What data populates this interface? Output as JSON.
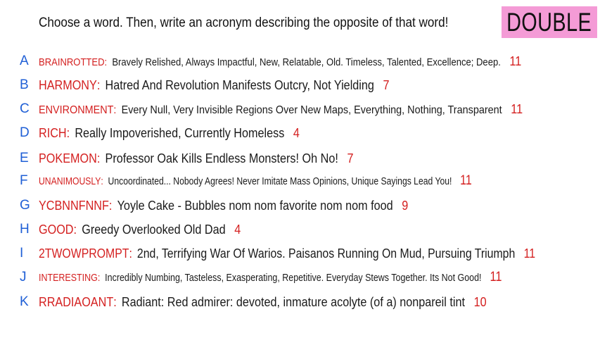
{
  "prompt": "Choose a word. Then, write an acronym describing the opposite of that word!",
  "badge": "DOUBLE",
  "answers": [
    {
      "letter": "A",
      "word": "BRAINROTTED",
      "acronym": "Bravely Relished, Always Impactful, New, Relatable, Old. Timeless, Talented, Excellence; Deep.",
      "count": "11"
    },
    {
      "letter": "B",
      "word": "HARMONY",
      "acronym": "Hatred And Revolution Manifests Outcry, Not Yielding",
      "count": "7"
    },
    {
      "letter": "C",
      "word": "ENVIRONMENT",
      "acronym": "Every Null, Very Invisible Regions Over New Maps, Everything, Nothing, Transparent",
      "count": "11"
    },
    {
      "letter": "D",
      "word": "RICH",
      "acronym": "Really Impoverished, Currently Homeless",
      "count": "4"
    },
    {
      "letter": "E",
      "word": "POKEMON",
      "acronym": "Professor Oak Kills Endless Monsters! Oh No!",
      "count": "7"
    },
    {
      "letter": "F",
      "word": "UNANIMOUSLY",
      "acronym": "Uncoordinated... Nobody Agrees! Never Imitate Mass Opinions, Unique Sayings Lead You!",
      "count": "11"
    },
    {
      "letter": "G",
      "word": "YCBNNFNNF",
      "acronym": "Yoyle Cake - Bubbles nom nom favorite nom nom food",
      "count": "9"
    },
    {
      "letter": "H",
      "word": "GOOD",
      "acronym": "Greedy Overlooked Old Dad",
      "count": "4"
    },
    {
      "letter": "I",
      "word": "2TWOWPROMPT",
      "acronym": "2nd, Terrifying War Of Warios. Paisanos Running On Mud, Pursuing Triumph",
      "count": "11"
    },
    {
      "letter": "J",
      "word": "INTERESTING",
      "acronym": "Incredibly Numbing, Tasteless, Exasperating, Repetitive. Everyday Stews Together. Its Not Good!",
      "count": "11"
    },
    {
      "letter": "K",
      "word": "RRADIAOANT",
      "acronym": "Radiant: Red admirer: devoted, inmature acolyte (of a) nonpareil tint",
      "count": "10"
    }
  ],
  "colors": {
    "letter": "#1f5fd6",
    "word": "#d42020",
    "count": "#d42020",
    "badge_bg": "#f49bd6"
  }
}
